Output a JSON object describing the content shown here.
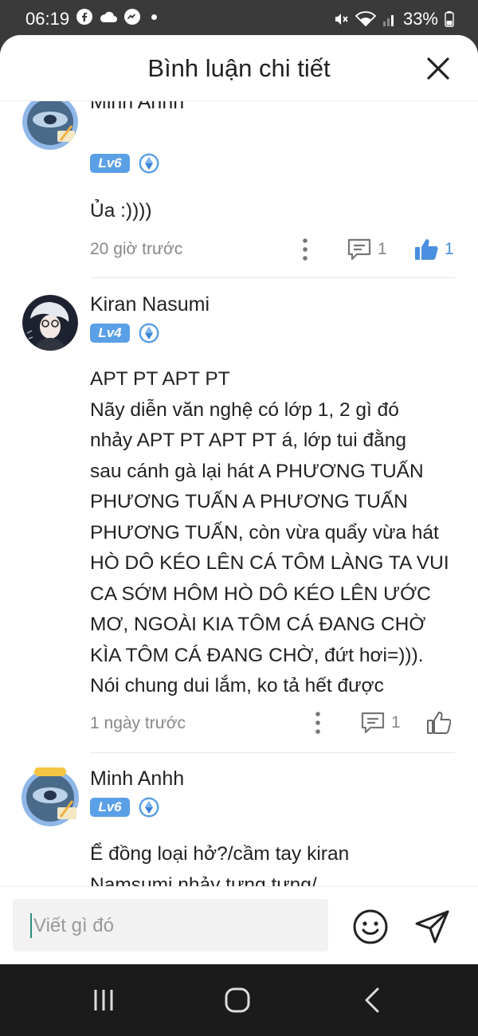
{
  "status_bar": {
    "time": "06:19",
    "battery": "33%",
    "icons": [
      "facebook-icon",
      "cloud-icon",
      "messenger-icon",
      "dot-icon",
      "mute-icon",
      "wifi-icon",
      "signal-icon",
      "battery-icon"
    ]
  },
  "sheet": {
    "title": "Bình luận chi tiết"
  },
  "comments": [
    {
      "name": "Minh Anhh",
      "level": "Lv6",
      "text": "Ủa :))))",
      "time": "20 giờ trước",
      "replies": "1",
      "likes": "1",
      "liked": true
    },
    {
      "name": "Kiran Nasumi",
      "level": "Lv4",
      "lines": [
        "APT PT APT PT",
        "Nãy diễn văn nghệ có lớp 1, 2 gì đó",
        "nhảy APT PT APT PT á, lớp tui đằng",
        "sau cánh gà lại hát A PHƯƠNG TUẤN",
        "PHƯƠNG TUẤN A PHƯƠNG TUẤN",
        "PHƯƠNG TUẤN, còn vừa quẩy vừa hát",
        "HÒ DÔ KÉO LÊN CÁ TÔM LÀNG TA VUI",
        "CA SỚM HÔM HÒ DÔ KÉO LÊN ƯỚC",
        "MƠ, NGOÀI KIA TÔM CÁ ĐANG CHỜ",
        "KÌA TÔM CÁ ĐANG CHỜ, đứt hơi=))).",
        "Nói chung dui lắm, ko tả hết được"
      ],
      "time": "1 ngày trước",
      "replies": "1",
      "liked": false
    },
    {
      "name": "Minh Anhh",
      "level": "Lv6",
      "lines": [
        "Ể đồng loại hở?/cầm tay kiran",
        "Namsumi nhảy tưng tưng/"
      ]
    }
  ],
  "composer": {
    "placeholder": "Viết gì đó"
  },
  "colors": {
    "accent_blue": "#4a8fe0",
    "level_badge": "#5aa0e6"
  }
}
